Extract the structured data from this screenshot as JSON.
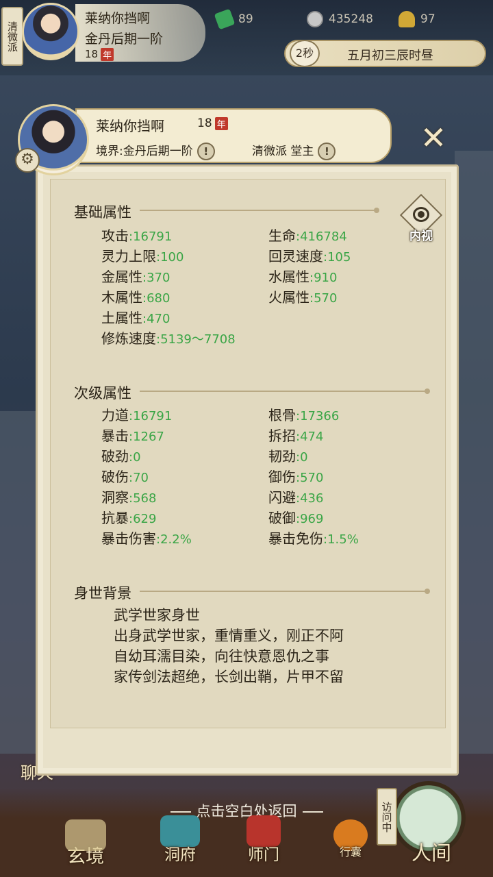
{
  "hud": {
    "sect_tag": "清微派",
    "name": "莱纳你挡啊",
    "realm": "金丹后期一阶",
    "age": "18",
    "age_badge": "年",
    "resources": [
      {
        "icon": "jade-icon",
        "value": "89"
      },
      {
        "icon": "coin-icon",
        "value": "435248"
      },
      {
        "icon": "strength-icon",
        "value": "97"
      }
    ],
    "timer": "2秒",
    "game_time": "五月初三辰时昼"
  },
  "panel": {
    "name": "莱纳你挡啊",
    "age": "18",
    "age_badge": "年",
    "realm_label": "境界:金丹后期一阶",
    "sect_label": "清微派 堂主",
    "inner_view_label": "内视",
    "basic": {
      "title": "基础属性",
      "attrs": [
        {
          "label": "攻击",
          "value": ":16791"
        },
        {
          "label": "生命",
          "value": ":416784"
        },
        {
          "label": "灵力上限",
          "value": ":100"
        },
        {
          "label": "回灵速度",
          "value": ":105"
        },
        {
          "label": "金属性",
          "value": ":370"
        },
        {
          "label": "水属性",
          "value": ":910"
        },
        {
          "label": "木属性",
          "value": ":680"
        },
        {
          "label": "火属性",
          "value": ":570"
        },
        {
          "label": "土属性",
          "value": ":470"
        },
        {
          "label": "修炼速度",
          "value": ":5139～7708"
        }
      ]
    },
    "secondary": {
      "title": "次级属性",
      "attrs": [
        {
          "label": "力道",
          "value": ":16791"
        },
        {
          "label": "根骨",
          "value": ":17366"
        },
        {
          "label": "暴击",
          "value": ":1267"
        },
        {
          "label": "拆招",
          "value": ":474"
        },
        {
          "label": "破劲",
          "value": ":0"
        },
        {
          "label": "韧劲",
          "value": ":0"
        },
        {
          "label": "破伤",
          "value": ":70"
        },
        {
          "label": "御伤",
          "value": ":570"
        },
        {
          "label": "洞察",
          "value": ":568"
        },
        {
          "label": "闪避",
          "value": ":436"
        },
        {
          "label": "抗暴",
          "value": ":629"
        },
        {
          "label": "破御",
          "value": ":969"
        },
        {
          "label": "暴击伤害",
          "value": ":2.2%"
        },
        {
          "label": "暴击免伤",
          "value": ":1.5%"
        }
      ]
    },
    "background": {
      "title": "身世背景",
      "lines": [
        "武学世家身世",
        "出身武学世家，重情重义，刚正不阿",
        "自幼耳濡目染，向往快意恩仇之事",
        "家传剑法超绝，长剑出鞘，片甲不留"
      ]
    }
  },
  "chat_label": "聊天",
  "back_hint": "点击空白处返回",
  "nav": {
    "items": [
      "玄境",
      "洞府",
      "师门",
      "行囊",
      "人间"
    ],
    "visit_tag": "访问中"
  },
  "colors": {
    "value_green": "#3aa546",
    "panel_bg": "#e8e1c9",
    "accent_gold": "#b7a06a"
  }
}
